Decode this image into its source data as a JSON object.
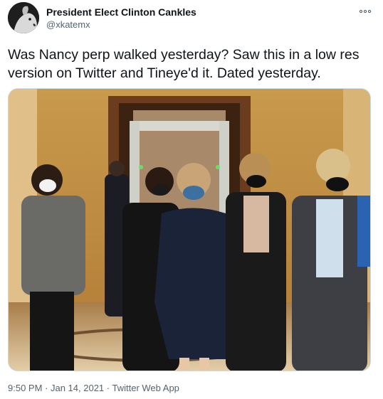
{
  "user": {
    "display_name": "President Elect Clinton Cankles",
    "handle": "@xkatemx"
  },
  "more_icon": "more-horizontal-icon",
  "tweet": {
    "text_line1": "Was Nancy perp walked yesterday? Saw this in a low res",
    "text_line2": "version on Twitter and Tineye'd it. Dated yesterday."
  },
  "meta": {
    "time": "9:50 PM",
    "sep1": " · ",
    "date": "Jan 14, 2021",
    "sep2": " · ",
    "source": "Twitter Web App"
  }
}
